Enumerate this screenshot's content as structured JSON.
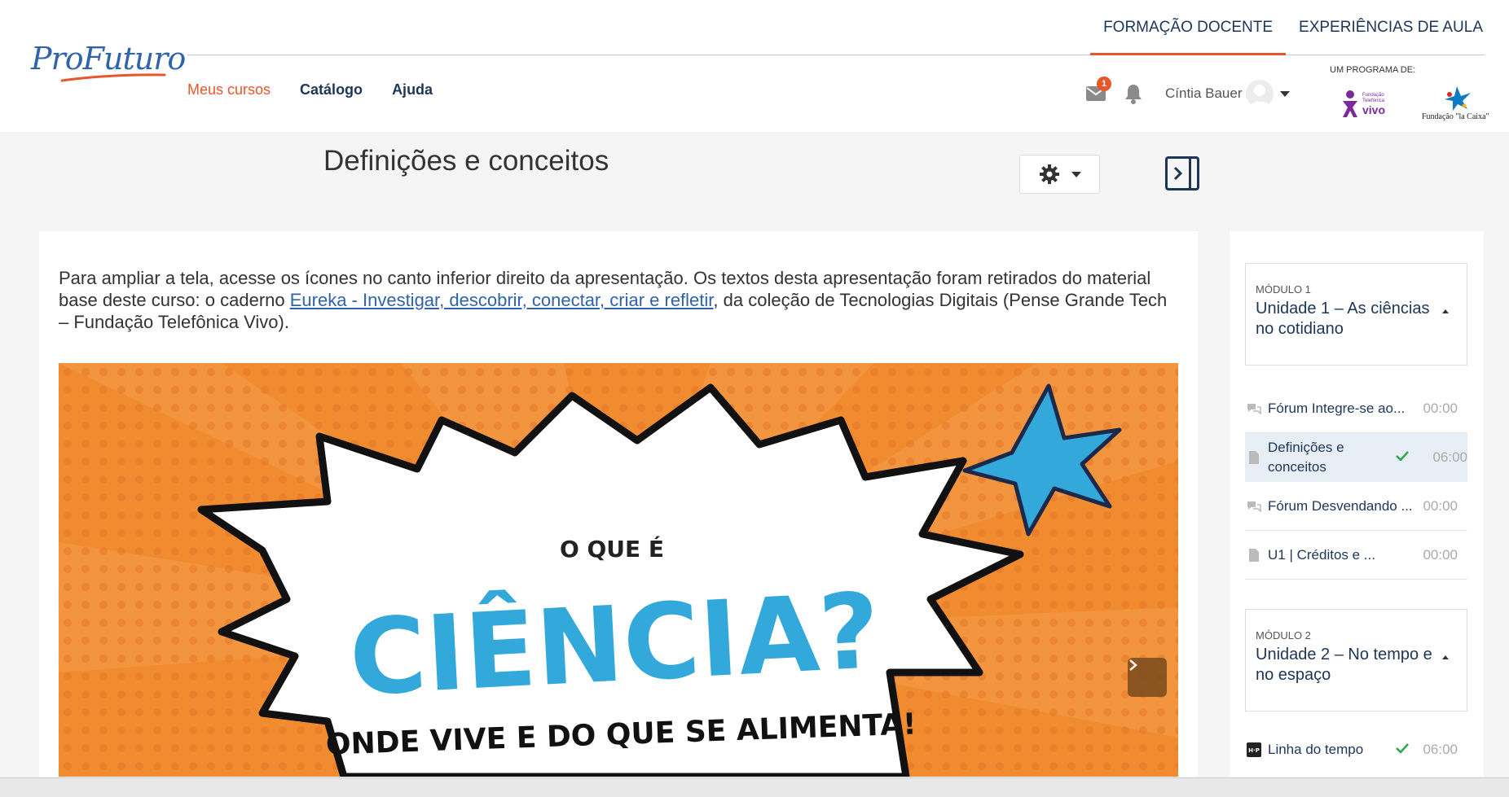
{
  "brand": {
    "logo_text": "ProFuturo",
    "accent": "#e8572b",
    "primary": "#1d3557"
  },
  "top_nav": [
    {
      "label": "FORMAÇÃO DOCENTE",
      "active": true
    },
    {
      "label": "EXPERIÊNCIAS DE AULA",
      "active": false
    }
  ],
  "main_nav": [
    {
      "label": "Meus cursos",
      "active": true
    },
    {
      "label": "Catálogo",
      "active": false
    },
    {
      "label": "Ajuda",
      "active": false
    }
  ],
  "user": {
    "messages_icon": "envelope-icon",
    "messages_badge": "1",
    "notifications_icon": "bell-icon",
    "name": "Cíntia Bauer"
  },
  "program": {
    "label": "UM PROGRAMA DE:",
    "partner_vivo": "Fundação Telefónica vivo",
    "partner_caixa": "Fundação \"la Caixa\""
  },
  "page": {
    "title": "Definições e conceitos",
    "settings_icon": "gear-icon",
    "drawer_icon": "drawer-toggle-icon"
  },
  "content": {
    "intro_before": "Para ampliar a tela, acesse os ícones no canto inferior direito da apresentação. Os textos desta apresentação foram retirados do material base deste curso: o caderno ",
    "intro_link": "Eureka - Investigar, descobrir, conectar, criar e refletir",
    "intro_after": ", da coleção de Tecnologias Digitais (Pense Grande Tech – Fundação Telefônica Vivo).",
    "slide": {
      "line1": "O QUE É",
      "line2": "CIÊNCIA?",
      "line3": "ONDE VIVE E DO QUE SE ALIMENTA!",
      "next_icon": "chevron-right-icon"
    }
  },
  "sidebar": {
    "modules": [
      {
        "label": "MÓDULO 1",
        "title": "Unidade 1 – As ciências no cotidiano",
        "activities": [
          {
            "name": "Fórum Integre-se ao...",
            "time": "00:00",
            "icon": "forum-icon",
            "done": false,
            "current": false
          },
          {
            "name": "Definições e conceitos",
            "time": "06:00",
            "icon": "file-icon",
            "done": true,
            "current": true
          },
          {
            "name": "Fórum Desvendando ...",
            "time": "00:00",
            "icon": "forum-icon",
            "done": false,
            "current": false
          },
          {
            "name": "U1 | Créditos e ...",
            "time": "00:00",
            "icon": "file-icon",
            "done": false,
            "current": false
          }
        ]
      },
      {
        "label": "MÓDULO 2",
        "title": "Unidade 2 – No tempo e no espaço",
        "activities": [
          {
            "name": "Linha do tempo",
            "time": "06:00",
            "icon": "h5p-icon",
            "done": true,
            "current": false
          }
        ]
      }
    ]
  }
}
